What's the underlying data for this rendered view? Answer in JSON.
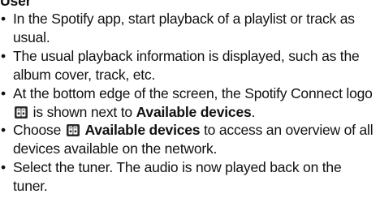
{
  "header": {
    "fragment": "User"
  },
  "steps": [
    {
      "text": "In the Spotify app, start playback of a playlist or track as usual."
    },
    {
      "text": "The usual playback information is displayed, such as the album cover, track, etc."
    },
    {
      "before": "At the bottom edge of the screen, the Spotify Connect logo",
      "middle": "is shown next to",
      "bold": "Available devices",
      "after": "."
    },
    {
      "before": "Choose",
      "bold": "Available devices",
      "after": "to access an overview of all devices available on the network."
    },
    {
      "text": "Select the tuner. The audio is now played back on the tuner."
    }
  ],
  "icons": {
    "connect_logo": "spotify-connect-logo-icon",
    "bullet": "bullet-icon"
  }
}
